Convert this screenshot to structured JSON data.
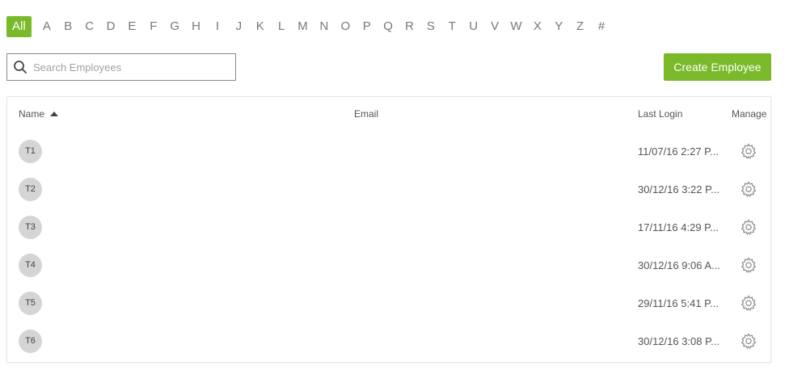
{
  "alphabet": {
    "all_label": "All",
    "letters": [
      "A",
      "B",
      "C",
      "D",
      "E",
      "F",
      "G",
      "H",
      "I",
      "J",
      "K",
      "L",
      "M",
      "N",
      "O",
      "P",
      "Q",
      "R",
      "S",
      "T",
      "U",
      "V",
      "W",
      "X",
      "Y",
      "Z",
      "#"
    ]
  },
  "search": {
    "placeholder": "Search Employees",
    "value": ""
  },
  "actions": {
    "create_label": "Create Employee"
  },
  "colors": {
    "accent": "#7ab92a",
    "avatar_bg": "#d5d5d5",
    "border": "#e6e6e6"
  },
  "table": {
    "headers": {
      "name": "Name",
      "email": "Email",
      "last_login": "Last Login",
      "manage": "Manage"
    },
    "sort": {
      "column": "name",
      "direction": "ascending"
    },
    "rows": [
      {
        "initials": "T1",
        "email": "",
        "last_login": "11/07/16 2:27 P..."
      },
      {
        "initials": "T2",
        "email": "",
        "last_login": "30/12/16 3:22 P..."
      },
      {
        "initials": "T3",
        "email": "",
        "last_login": "17/11/16 4:29 P..."
      },
      {
        "initials": "T4",
        "email": "",
        "last_login": "30/12/16 9:06 A..."
      },
      {
        "initials": "T5",
        "email": "",
        "last_login": "29/11/16 5:41 P..."
      },
      {
        "initials": "T6",
        "email": "",
        "last_login": "30/12/16 3:08 P..."
      }
    ]
  }
}
